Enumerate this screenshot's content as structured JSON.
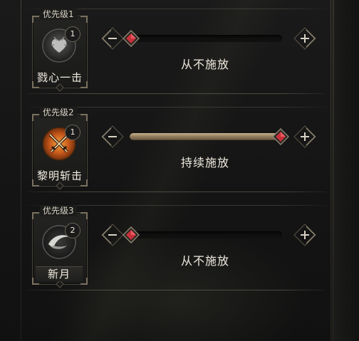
{
  "skills": [
    {
      "priority_label": "优先级1",
      "name": "戮心一击",
      "count": "1",
      "status": "从不施放",
      "level": 0,
      "icon": "heart-skill-icon",
      "name_style": "plain"
    },
    {
      "priority_label": "优先级2",
      "name": "黎明斩击",
      "count": "1",
      "status": "持续施放",
      "level": 1,
      "icon": "crossed-swords-skill-icon",
      "name_style": "plain"
    },
    {
      "priority_label": "优先级3",
      "name": "新月",
      "count": "2",
      "status": "从不施放",
      "level": 0,
      "icon": "crescent-moon-skill-icon",
      "name_style": "boxed"
    }
  ],
  "controls": {
    "minus_icon": "minus-icon",
    "plus_icon": "plus-icon",
    "thumb_icon": "red-diamond-thumb-icon"
  },
  "colors": {
    "background": "#141414",
    "slider_fill": "#8a7658",
    "thumb_gem": "#c8303a",
    "dawn_icon_orange": "#d7711f"
  }
}
